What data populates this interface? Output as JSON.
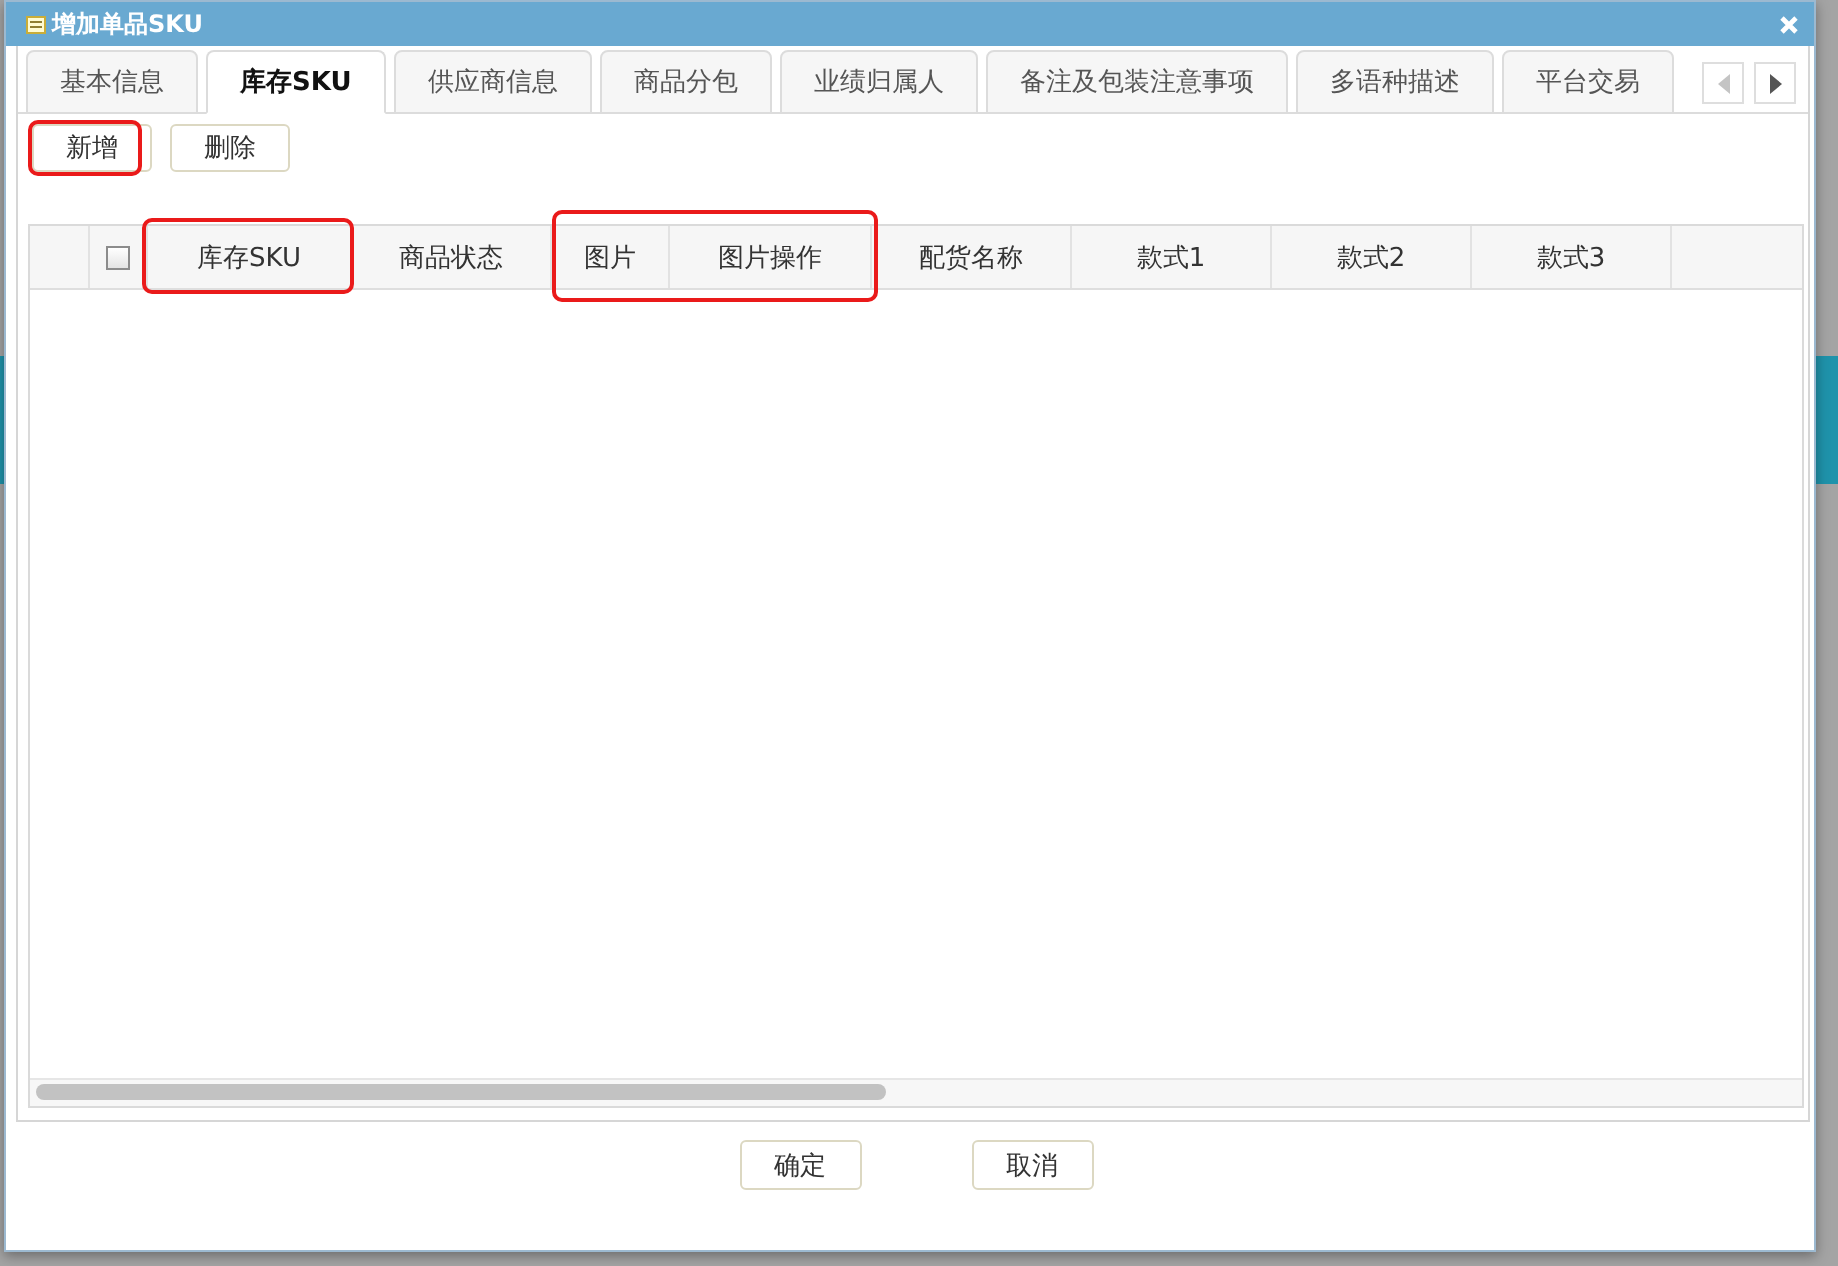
{
  "window": {
    "title": "增加单品SKU"
  },
  "tabs": [
    {
      "label": "基本信息",
      "selected": false
    },
    {
      "label": "库存SKU",
      "selected": true
    },
    {
      "label": "供应商信息",
      "selected": false
    },
    {
      "label": "商品分包",
      "selected": false
    },
    {
      "label": "业绩归属人",
      "selected": false
    },
    {
      "label": "备注及包装注意事项",
      "selected": false
    },
    {
      "label": "多语种描述",
      "selected": false
    },
    {
      "label": "平台交易",
      "selected": false
    }
  ],
  "tab_scroll": {
    "prev_disabled": true,
    "next_disabled": false
  },
  "toolbar": [
    {
      "label": "新增",
      "highlighted": true
    },
    {
      "label": "删除",
      "highlighted": false
    }
  ],
  "table": {
    "select_all_checked": false,
    "columns": [
      {
        "label": "库存SKU",
        "highlighted": true
      },
      {
        "label": "商品状态",
        "highlighted": false
      },
      {
        "label": "图片",
        "highlighted": true
      },
      {
        "label": "图片操作",
        "highlighted": true
      },
      {
        "label": "配货名称",
        "highlighted": false
      },
      {
        "label": "款式1",
        "highlighted": false
      },
      {
        "label": "款式2",
        "highlighted": false
      },
      {
        "label": "款式3",
        "highlighted": false
      }
    ]
  },
  "footer_buttons": [
    "确定",
    "取消"
  ]
}
